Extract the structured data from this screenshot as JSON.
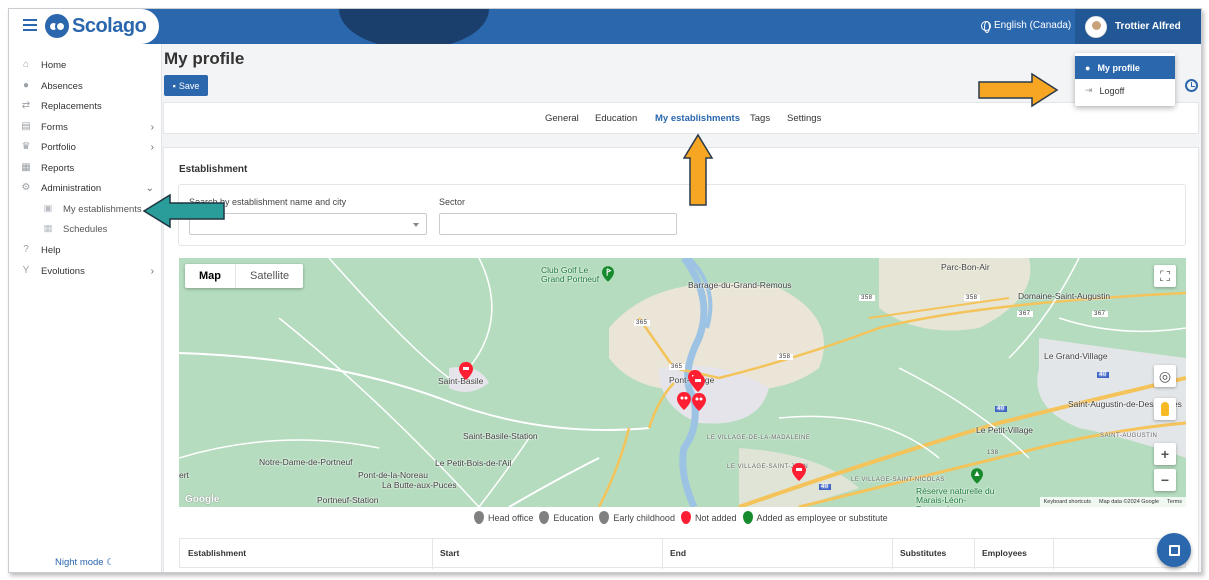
{
  "app": {
    "name": "Scolago",
    "language": "English (Canada)",
    "user": "Trottier Alfred"
  },
  "user_menu": {
    "items": [
      {
        "label": "My profile",
        "icon": "user-icon",
        "active": true
      },
      {
        "label": "Logoff",
        "icon": "logout-icon",
        "active": false
      }
    ]
  },
  "sidebar": {
    "items": [
      {
        "label": "Home",
        "icon": "home-icon"
      },
      {
        "label": "Absences",
        "icon": "absences-icon"
      },
      {
        "label": "Replacements",
        "icon": "replacements-icon"
      },
      {
        "label": "Forms",
        "icon": "forms-icon",
        "chevron": "›"
      },
      {
        "label": "Portfolio",
        "icon": "trophy-icon",
        "chevron": "›"
      },
      {
        "label": "Reports",
        "icon": "reports-icon"
      },
      {
        "label": "Administration",
        "icon": "gear-icon",
        "chevron": "⌄"
      }
    ],
    "sub_items": [
      {
        "label": "My establishments",
        "icon": "school-icon"
      },
      {
        "label": "Schedules",
        "icon": "calendar-icon"
      }
    ],
    "bottom_items": [
      {
        "label": "Help",
        "icon": "help-icon"
      },
      {
        "label": "Evolutions",
        "icon": "evolutions-icon",
        "chevron": "›"
      }
    ],
    "night_mode": "Night mode ☾"
  },
  "page": {
    "title": "My profile",
    "save_label": "Save"
  },
  "tabs": [
    {
      "label": "General",
      "active": false
    },
    {
      "label": "Education",
      "active": false
    },
    {
      "label": "My establishments",
      "active": true
    },
    {
      "label": "Tags",
      "active": false
    },
    {
      "label": "Settings",
      "active": false
    }
  ],
  "establishment": {
    "title": "Establishment",
    "search_label": "Search by establishment name and city",
    "sector_label": "Sector",
    "search_value": "",
    "sector_value": ""
  },
  "map": {
    "toggle": {
      "map": "Map",
      "satellite": "Satellite"
    },
    "places": [
      "Parc-Bon-Air",
      "Club Golf Le Grand Portneuf",
      "Barrage-du-Grand-Remous",
      "Domaine-Saint-Augustin",
      "Le Grand-Village",
      "Saint-Basile",
      "Pont-Rouge",
      "Saint-Augustin-de-Desmaures",
      "Saint-Basile-Station",
      "LE VILLAGE-DE-LA-MADALEINE",
      "Le Petit-Village",
      "SAINT-AUGUSTIN",
      "Notre-Dame-de-Portneuf",
      "Pont-de-la-Noreau",
      "Le Petit-Bois-de-l'Ail",
      "La Butte-aux-Puces",
      "LE VILLAGE-SAINT-JEAN",
      "LE VILLAGE-SAINT-NICOLAS",
      "Réserve naturelle du Marais-Léon-Provancher",
      "Portneuf-Station",
      "ert"
    ],
    "roads": [
      "365",
      "365",
      "358",
      "358",
      "358",
      "367",
      "367",
      "40",
      "40",
      "40",
      "138"
    ],
    "footer": [
      "Keyboard shortcuts",
      "Map data ©2024 Google",
      "Terms"
    ],
    "attribution": "Google"
  },
  "legend": [
    {
      "label": "Head office",
      "color": "#808080"
    },
    {
      "label": "Education",
      "color": "#808080"
    },
    {
      "label": "Early childhood",
      "color": "#808080"
    },
    {
      "label": "Not added",
      "color": "#ff1f33"
    },
    {
      "label": "Added as employee or substitute",
      "color": "#178a2e"
    }
  ],
  "table": {
    "headers": [
      "Establishment",
      "Start",
      "End",
      "Substitutes",
      "Employees"
    ]
  },
  "colors": {
    "primary": "#2b67ad",
    "annotation_orange": "#f7a623",
    "annotation_teal": "#2a9d9a"
  }
}
